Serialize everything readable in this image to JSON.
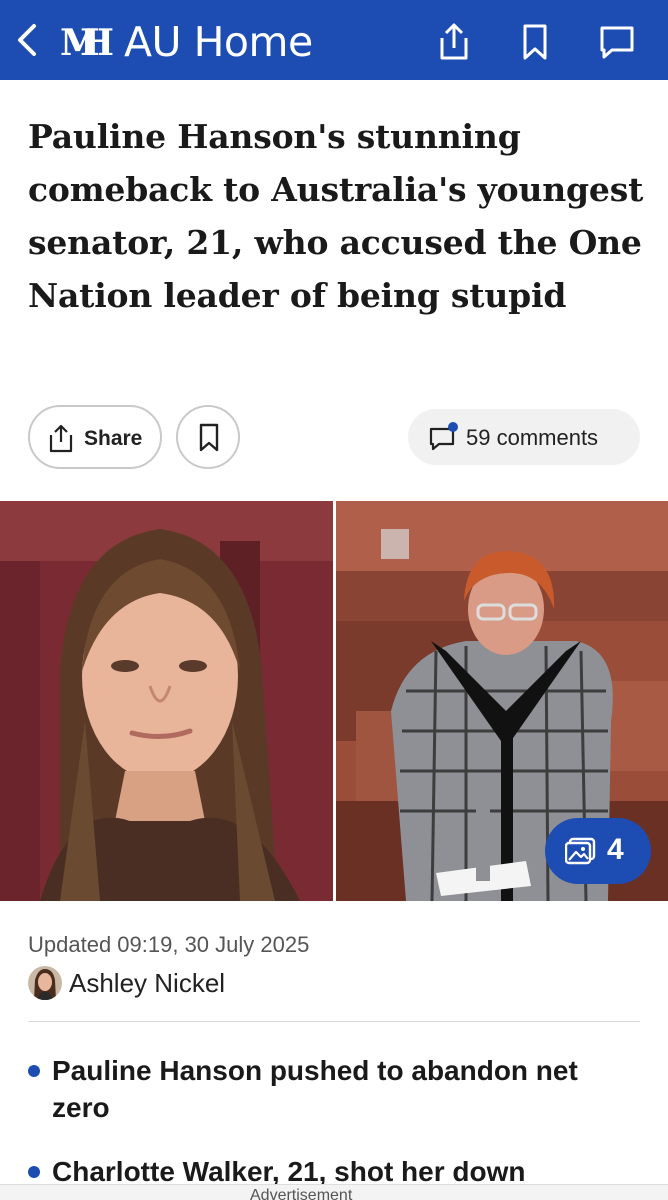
{
  "topbar": {
    "title": "AU Home",
    "back_icon": "chevron-left-icon",
    "logo_icon": "dailymail-logo-icon",
    "share_icon": "share-icon",
    "bookmark_icon": "bookmark-icon",
    "comments_icon": "comment-icon",
    "color": "#1d4db2"
  },
  "article": {
    "headline": "Pauline Hanson's stunning comeback to Australia's youngest senator, 21, who accused the One Nation leader of being stupid",
    "share_label": "Share",
    "comments_label": "59 comments",
    "gallery_count": "4",
    "updated": "Updated 09:19, 30 July 2025",
    "author": "Ashley Nickel",
    "bullets": [
      "Pauline Hanson pushed to abandon net zero",
      "Charlotte Walker, 21, shot her down"
    ],
    "ad_label": "Advertisement"
  }
}
